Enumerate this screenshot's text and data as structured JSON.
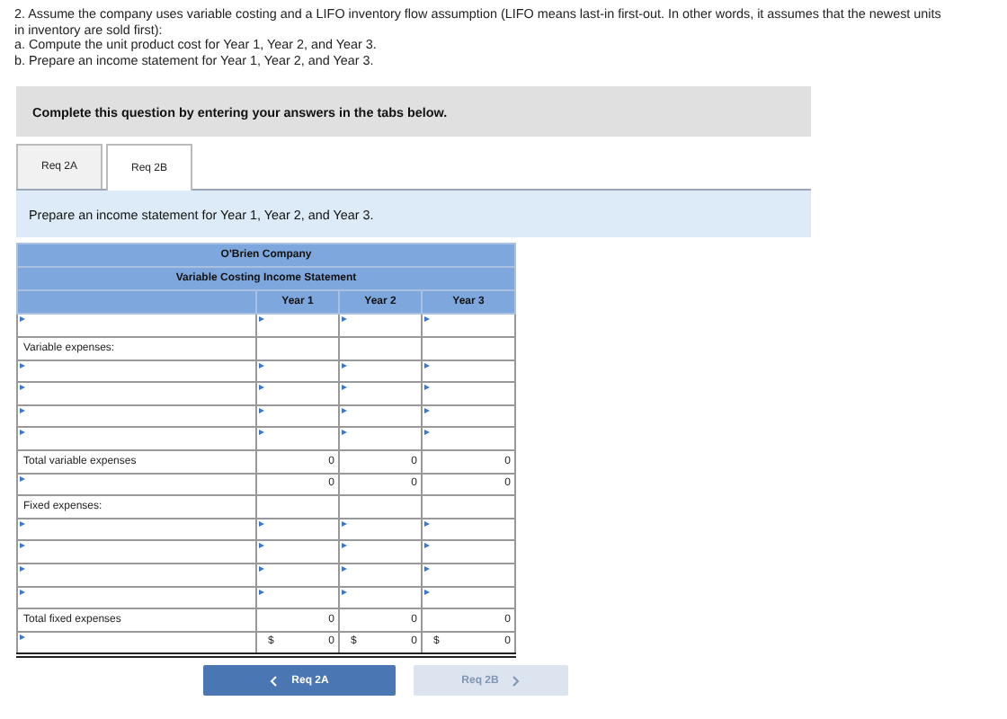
{
  "question": {
    "paragraphs": [
      "2. Assume the company uses variable costing and a LIFO inventory flow assumption (LIFO means last-in first-out. In other words, it assumes that the newest units in inventory are sold first):",
      "a. Compute the unit product cost for Year 1, Year 2, and Year 3.",
      "b. Prepare an income statement for Year 1, Year 2, and Year 3."
    ]
  },
  "instruction_banner": "Complete this question by entering your answers in the tabs below.",
  "tabs": [
    {
      "label": "Req 2A",
      "selected": false
    },
    {
      "label": "Req 2B",
      "selected": true
    }
  ],
  "tab_prompt": "Prepare an income statement for Year 1, Year 2, and Year 3.",
  "statement": {
    "company": "O'Brien Company",
    "title": "Variable Costing Income Statement",
    "columns": [
      "Year 1",
      "Year 2",
      "Year 3"
    ],
    "rows": [
      {
        "kind": "input"
      },
      {
        "kind": "heading",
        "label": "Variable expenses:"
      },
      {
        "kind": "input"
      },
      {
        "kind": "input"
      },
      {
        "kind": "input"
      },
      {
        "kind": "input"
      },
      {
        "kind": "total",
        "label": "Total variable expenses",
        "values": [
          {
            "amount": "0"
          },
          {
            "amount": "0"
          },
          {
            "amount": "0"
          }
        ]
      },
      {
        "kind": "computed",
        "values": [
          {
            "amount": "0"
          },
          {
            "amount": "0"
          },
          {
            "amount": "0"
          }
        ]
      },
      {
        "kind": "heading",
        "label": "Fixed expenses:"
      },
      {
        "kind": "input"
      },
      {
        "kind": "input"
      },
      {
        "kind": "input"
      },
      {
        "kind": "input"
      },
      {
        "kind": "total",
        "label": "Total fixed expenses",
        "values": [
          {
            "amount": "0"
          },
          {
            "amount": "0"
          },
          {
            "amount": "0"
          }
        ]
      },
      {
        "kind": "computed",
        "final": true,
        "values": [
          {
            "currency": "$",
            "amount": "0"
          },
          {
            "currency": "$",
            "amount": "0"
          },
          {
            "currency": "$",
            "amount": "0"
          }
        ]
      }
    ]
  },
  "nav_buttons": [
    {
      "label": "Req 2A",
      "kind": "prev",
      "disabled": false
    },
    {
      "label": "Req 2B",
      "kind": "next",
      "disabled": true
    }
  ]
}
